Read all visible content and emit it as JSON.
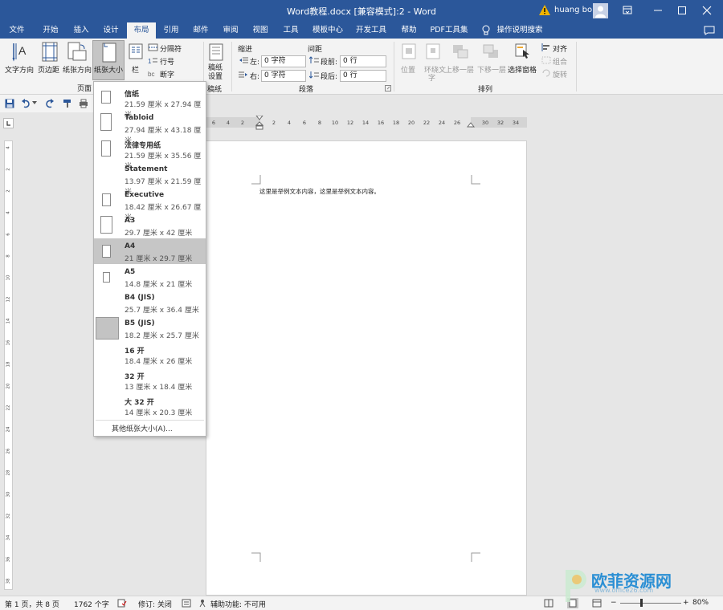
{
  "title_bar": {
    "title": "Word教程.docx [兼容模式]:2  -  Word",
    "user": "huang bo"
  },
  "tabs": [
    {
      "label": "文件"
    },
    {
      "label": "开始"
    },
    {
      "label": "插入"
    },
    {
      "label": "设计"
    },
    {
      "label": "布局",
      "active": true
    },
    {
      "label": "引用"
    },
    {
      "label": "邮件"
    },
    {
      "label": "审阅"
    },
    {
      "label": "视图"
    },
    {
      "label": "工具"
    },
    {
      "label": "模板中心"
    },
    {
      "label": "开发工具"
    },
    {
      "label": "帮助"
    },
    {
      "label": "PDF工具集"
    },
    {
      "label": "操作说明搜索"
    }
  ],
  "ribbon": {
    "page_setup": {
      "text_direction": "文字方向",
      "margins": "页边距",
      "orientation": "纸张方向",
      "size": "纸张大小",
      "columns": "栏",
      "breaks": "分隔符",
      "line_numbers": "行号",
      "hyphenation": "断字",
      "group_label": "页面"
    },
    "manuscript": {
      "label": "稿纸设置",
      "group_label": "稿纸"
    },
    "paragraph": {
      "indent_label": "缩进",
      "spacing_label": "间距",
      "left_label": "左:",
      "right_label": "右:",
      "before_label": "段前:",
      "after_label": "段后:",
      "left_value": "0 字符",
      "right_value": "0 字符",
      "before_value": "0 行",
      "after_value": "0 行",
      "group_label": "段落"
    },
    "arrange": {
      "position": "位置",
      "wrap_text_line1": "环绕文",
      "wrap_text_line2": "字",
      "bring_forward": "上移一层",
      "send_backward": "下移一层",
      "selection_pane": "选择窗格",
      "align": "对齐",
      "group": "组合",
      "rotate": "旋转",
      "group_label": "排列"
    }
  },
  "ruler_ticks": [
    "6",
    "4",
    "2",
    "2",
    "4",
    "6",
    "8",
    "10",
    "12",
    "14",
    "16",
    "18",
    "20",
    "22",
    "24",
    "26",
    "30",
    "32",
    "34"
  ],
  "vruler_ticks": [
    "4",
    "2",
    "2",
    "4",
    "6",
    "8",
    "10",
    "12",
    "14",
    "16",
    "18",
    "20",
    "22",
    "24",
    "26",
    "28",
    "30",
    "32",
    "34",
    "36",
    "38"
  ],
  "document": {
    "text": "这里是举例文本内容，这里是举例文本内容。"
  },
  "paper_sizes": [
    {
      "name": "信纸",
      "dims": "21.59 厘米 x 27.94 厘米"
    },
    {
      "name": "Tabloid",
      "dims": "27.94 厘米 x 43.18 厘米"
    },
    {
      "name": "法律专用纸",
      "dims": "21.59 厘米 x 35.56 厘米"
    },
    {
      "name": "Statement",
      "dims": "13.97 厘米 x 21.59 厘米"
    },
    {
      "name": "Executive",
      "dims": "18.42 厘米 x 26.67 厘米"
    },
    {
      "name": "A3",
      "dims": "29.7 厘米 x 42 厘米"
    },
    {
      "name": "A4",
      "dims": "21 厘米 x 29.7 厘米",
      "selected": true
    },
    {
      "name": "A5",
      "dims": "14.8 厘米 x 21 厘米"
    },
    {
      "name": "B4 (JIS)",
      "dims": "25.7 厘米 x 36.4 厘米"
    },
    {
      "name": "B5 (JIS)",
      "dims": "18.2 厘米 x 25.7 厘米"
    },
    {
      "name": "16 开",
      "dims": "18.4 厘米 x 26 厘米"
    },
    {
      "name": "32 开",
      "dims": "13 厘米 x 18.4 厘米"
    },
    {
      "name": "大 32 开",
      "dims": "14 厘米 x 20.3 厘米"
    }
  ],
  "more_sizes": "其他纸张大小(A)...",
  "status_bar": {
    "page": "第 1 页，共 8 页",
    "words": "1762 个字",
    "track": "修订: 关闭",
    "accessibility": "辅助功能: 不可用",
    "zoom": "80%"
  },
  "watermark": {
    "text": "欧菲资源网",
    "url": "www.office26.com"
  },
  "colors": {
    "accent": "#2b579a",
    "selected": "#c6c6c6"
  }
}
